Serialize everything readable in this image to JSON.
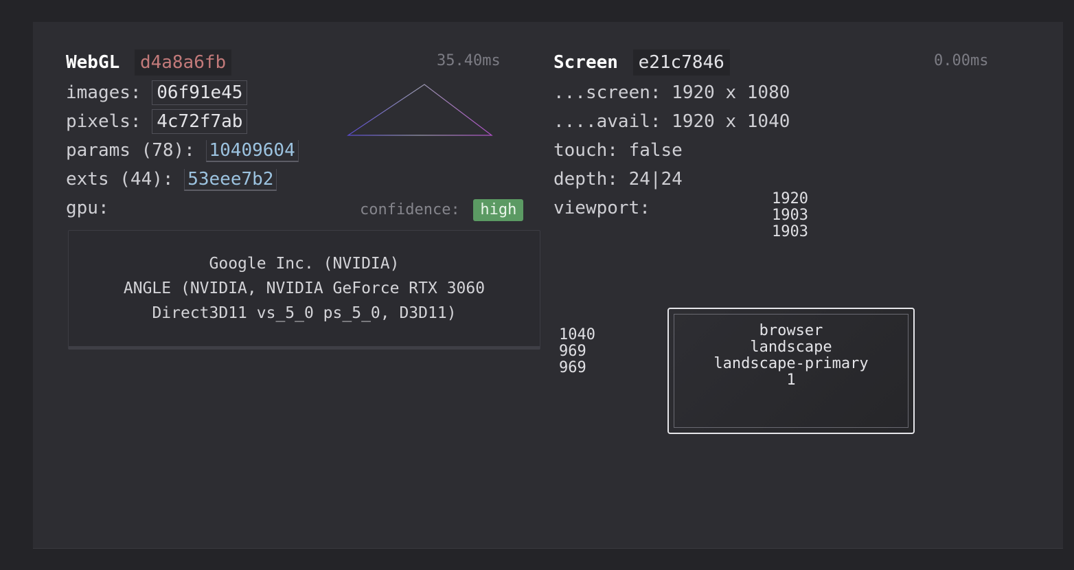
{
  "webgl": {
    "title": "WebGL",
    "hash": "d4a8a6fb",
    "timing": "35.40ms",
    "images_label": "images:",
    "images_hash": "06f91e45",
    "pixels_label": "pixels:",
    "pixels_hash": "4c72f7ab",
    "params_label": "params (78):",
    "params_hash": "10409604",
    "exts_label": "exts (44):",
    "exts_hash": "53eee7b2",
    "gpu_label": "gpu:",
    "confidence_label": "confidence:",
    "confidence_value": "high",
    "gpu_lines": [
      "Google Inc. (NVIDIA)",
      "ANGLE (NVIDIA, NVIDIA GeForce RTX 3060",
      "Direct3D11 vs_5_0 ps_5_0, D3D11)"
    ]
  },
  "screen": {
    "title": "Screen",
    "hash": "e21c7846",
    "timing": "0.00ms",
    "screen_line": "...screen: 1920 x 1080",
    "avail_line": "....avail: 1920 x 1040",
    "touch_line": "touch: false",
    "depth_line": "depth: 24|24",
    "viewport_label": "viewport:",
    "widths": [
      "1920",
      "1903",
      "1903"
    ],
    "heights": [
      "1040",
      "969",
      "969"
    ],
    "orientation": [
      "browser",
      "landscape",
      "landscape-primary",
      "1"
    ]
  },
  "colors": {
    "badge": "#5b9a63",
    "hash_red": "#c27a7a",
    "link": "#9cc3e0"
  }
}
